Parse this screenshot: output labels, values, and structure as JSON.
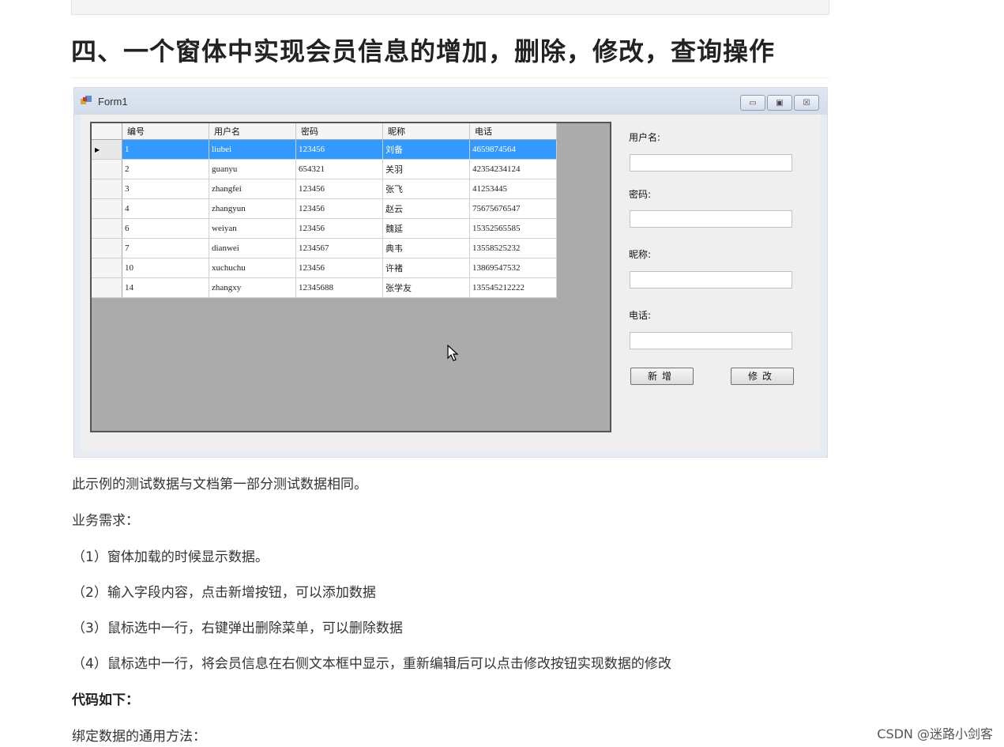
{
  "article": {
    "heading": "四、一个窗体中实现会员信息的增加，删除，修改，查询操作",
    "paragraphs": [
      "此示例的测试数据与文档第一部分测试数据相同。",
      "业务需求：",
      "（1）窗体加载的时候显示数据。",
      "（2）输入字段内容，点击新增按钮，可以添加数据",
      "（3）鼠标选中一行，右键弹出删除菜单，可以删除数据",
      "（4）鼠标选中一行，将会员信息在右侧文本框中显示，重新编辑后可以点击修改按钮实现数据的修改",
      "代码如下：",
      "绑定数据的通用方法："
    ]
  },
  "form": {
    "title": "Form1",
    "minimize_glyph": "▭",
    "maximize_glyph": "▣",
    "close_glyph": "☒",
    "columns": [
      "编号",
      "用户名",
      "密码",
      "昵称",
      "电话"
    ],
    "row_pointer": "▶",
    "selected_row": 0,
    "rows": [
      [
        "1",
        "liubei",
        "123456",
        "刘备",
        "4659874564"
      ],
      [
        "2",
        "guanyu",
        "654321",
        "关羽",
        "42354234124"
      ],
      [
        "3",
        "zhangfei",
        "123456",
        "张飞",
        "41253445"
      ],
      [
        "4",
        "zhangyun",
        "123456",
        "赵云",
        "75675676547"
      ],
      [
        "6",
        "weiyan",
        "123456",
        "魏延",
        "15352565585"
      ],
      [
        "7",
        "dianwei",
        "1234567",
        "典韦",
        "13558525232"
      ],
      [
        "10",
        "xuchuchu",
        "123456",
        "许褚",
        "13869547532"
      ],
      [
        "14",
        "zhangxy",
        "12345688",
        "张学友",
        "135545212222"
      ]
    ],
    "labels": {
      "username": "用户名:",
      "password": "密码:",
      "nickname": "昵称:",
      "phone": "电话:"
    },
    "values": {
      "username": "",
      "password": "",
      "nickname": "",
      "phone": ""
    },
    "buttons": {
      "add": "新增",
      "edit": "修改"
    }
  },
  "watermark": "CSDN @迷路小剑客",
  "icons": [
    "form-icon",
    "minimize-icon",
    "maximize-icon",
    "close-icon",
    "mouse-cursor-icon",
    "row-pointer-icon"
  ]
}
